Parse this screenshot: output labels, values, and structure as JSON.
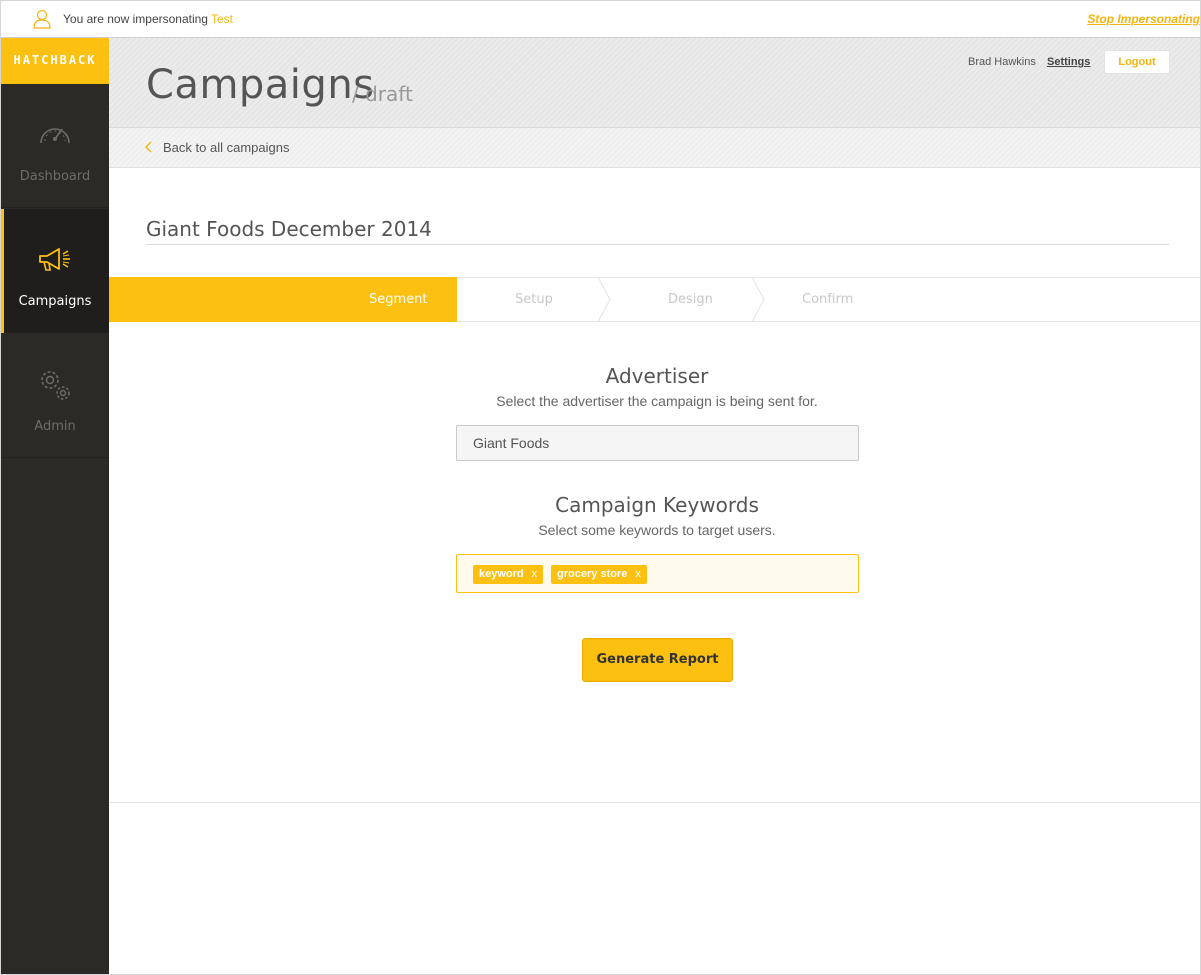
{
  "impersonation": {
    "prefix": "You are now impersonating",
    "user": "Test",
    "stop_label": "Stop Impersonating",
    "icon": "user-icon"
  },
  "brand": {
    "logo_text": "HATCHBACK",
    "accent_color": "#fcc010",
    "sidebar_color": "#2b2a27"
  },
  "sidebar": {
    "items": [
      {
        "label": "Dashboard",
        "icon": "speedometer-icon",
        "active": false
      },
      {
        "label": "Campaigns",
        "icon": "megaphone-icon",
        "active": true
      },
      {
        "label": "Admin",
        "icon": "gears-icon",
        "active": false
      }
    ]
  },
  "header": {
    "title": "Campaigns",
    "subtitle": "/ draft",
    "user_name": "Brad Hawkins",
    "settings_label": "Settings",
    "logout_label": "Logout"
  },
  "breadcrumb": {
    "back_label": "Back to all campaigns"
  },
  "campaign": {
    "name": "Giant Foods December 2014"
  },
  "steps": [
    {
      "label": "Segment",
      "active": true
    },
    {
      "label": "Setup",
      "active": false
    },
    {
      "label": "Design",
      "active": false
    },
    {
      "label": "Confirm",
      "active": false
    }
  ],
  "form": {
    "advertiser": {
      "title": "Advertiser",
      "description": "Select the advertiser the campaign is being sent for.",
      "value": "Giant Foods"
    },
    "keywords": {
      "title": "Campaign Keywords",
      "description": "Select some keywords to target users.",
      "tags": [
        {
          "label": "keyword",
          "remove": "x"
        },
        {
          "label": "grocery store",
          "remove": "x"
        }
      ]
    },
    "submit_label": "Generate Report"
  }
}
